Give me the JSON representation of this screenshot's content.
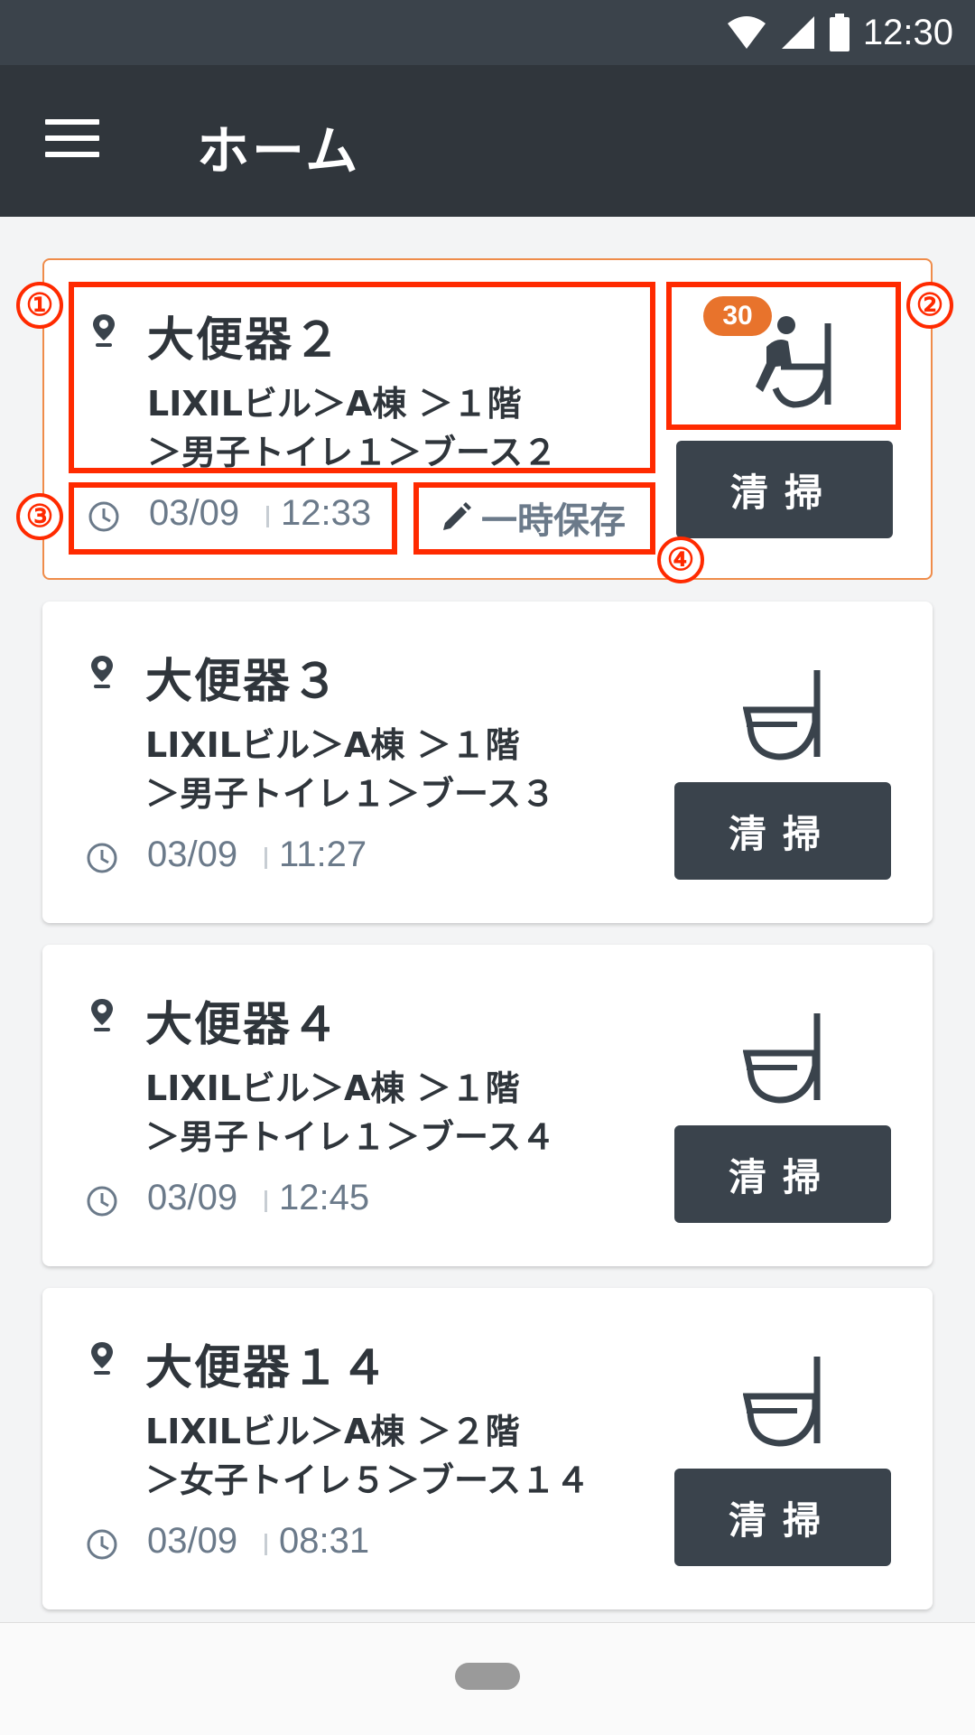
{
  "status_bar": {
    "time": "12:30"
  },
  "app_bar": {
    "title": "ホーム"
  },
  "cards": [
    {
      "name": "大便器２",
      "path_line1": "LIXILビル＞A棟 ＞１階",
      "path_line2": "＞男子トイレ１＞ブース２",
      "date": "03/09",
      "time": "12:33",
      "badge": "30",
      "draft_label": "一時保存",
      "button_label": "清掃"
    },
    {
      "name": "大便器３",
      "path_line1": "LIXILビル＞A棟 ＞１階",
      "path_line2": "＞男子トイレ１＞ブース３",
      "date": "03/09",
      "time": "11:27",
      "button_label": "清掃"
    },
    {
      "name": "大便器４",
      "path_line1": "LIXILビル＞A棟 ＞１階",
      "path_line2": "＞男子トイレ１＞ブース４",
      "date": "03/09",
      "time": "12:45",
      "button_label": "清掃"
    },
    {
      "name": "大便器１４",
      "path_line1": "LIXILビル＞A棟 ＞２階",
      "path_line2": "＞女子トイレ５＞ブース１４",
      "date": "03/09",
      "time": "08:31",
      "button_label": "清掃"
    }
  ],
  "callouts": [
    "①",
    "②",
    "③",
    "④"
  ],
  "colors": {
    "header": "#30363c",
    "status_bar": "#3b434b",
    "button": "#3a434c",
    "badge": "#e8732c",
    "callout": "#ff2a00",
    "selected_border": "#ef8c4a"
  }
}
